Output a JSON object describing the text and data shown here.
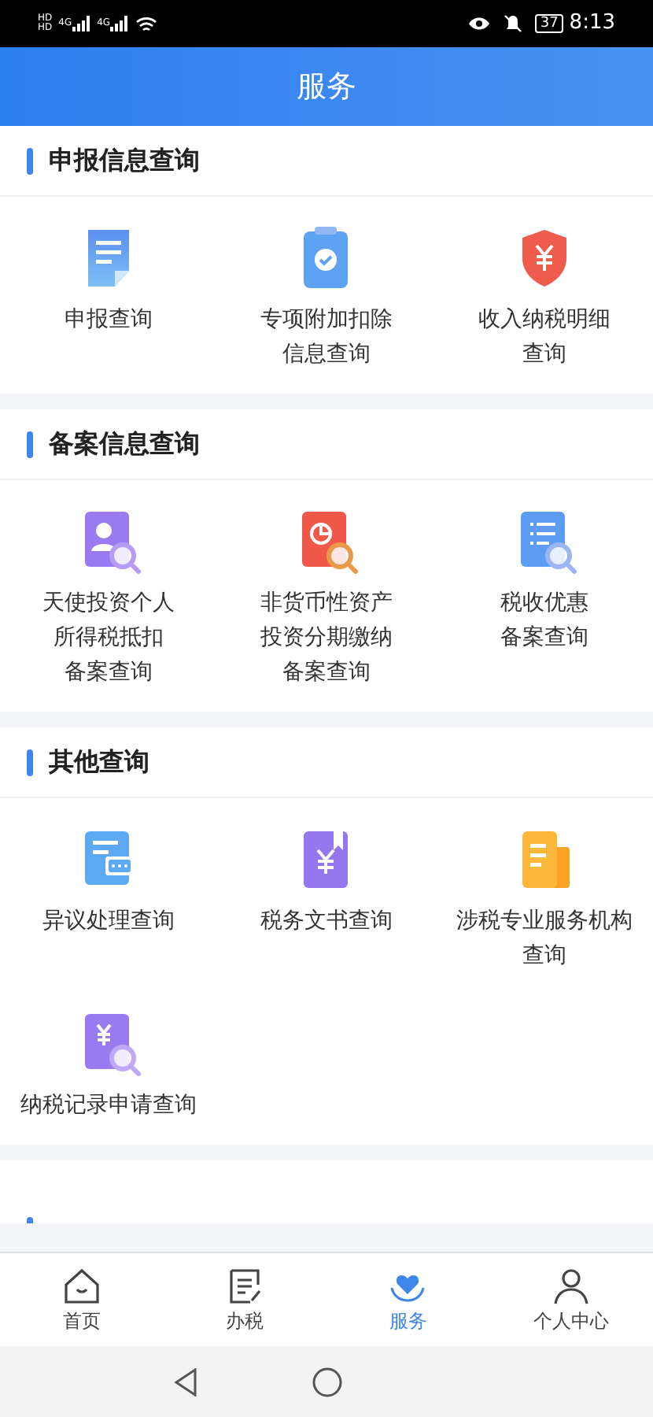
{
  "status_bar": {
    "sim_labels": [
      "HD",
      "HD"
    ],
    "network_labels": [
      "4G",
      "4G"
    ],
    "battery": "37",
    "time": "8:13"
  },
  "header": {
    "title": "服务"
  },
  "sections": [
    {
      "title": "申报信息查询",
      "items": [
        {
          "label_lines": [
            "申报查询"
          ],
          "kind": "doc"
        },
        {
          "label_lines": [
            "专项附加扣除",
            "信息查询"
          ],
          "kind": "clipboard"
        },
        {
          "label_lines": [
            "收入纳税明细",
            "查询"
          ],
          "kind": "shield"
        }
      ]
    },
    {
      "title": "备案信息查询",
      "items": [
        {
          "label_lines": [
            "天使投资个人",
            "所得税抵扣",
            "备案查询"
          ],
          "kind": "person"
        },
        {
          "label_lines": [
            "非货币性资产",
            "投资分期缴纳",
            "备案查询"
          ],
          "kind": "chart"
        },
        {
          "label_lines": [
            "税收优惠",
            "备案查询"
          ],
          "kind": "list"
        }
      ]
    },
    {
      "title": "其他查询",
      "items": [
        {
          "label_lines": [
            "异议处理查询"
          ],
          "kind": "chat"
        },
        {
          "label_lines": [
            "税务文书查询"
          ],
          "kind": "book"
        },
        {
          "label_lines": [
            "涉税专业服务机构",
            "查询"
          ],
          "kind": "building"
        },
        {
          "label_lines": [
            "纳税记录申请查询"
          ],
          "kind": "yen"
        }
      ]
    }
  ],
  "tabs": [
    {
      "label": "首页",
      "kind": "home",
      "selected": false
    },
    {
      "label": "办税",
      "kind": "form",
      "selected": false
    },
    {
      "label": "服务",
      "kind": "heart",
      "selected": true
    },
    {
      "label": "个人中心",
      "kind": "person",
      "selected": false
    }
  ]
}
